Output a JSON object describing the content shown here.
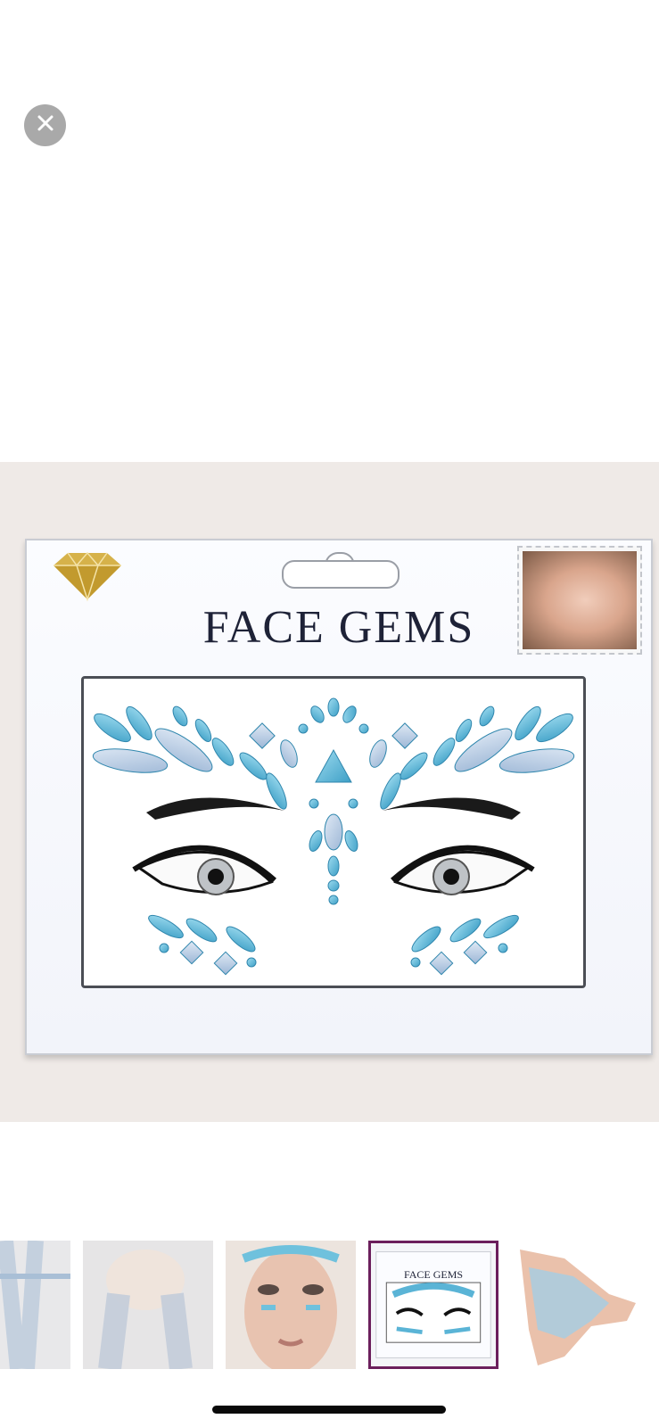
{
  "viewer": {
    "close_icon": "close-icon",
    "close_button_color": "#a9a9a9"
  },
  "product": {
    "package_title": "FACE GEMS",
    "background_color": "#efeae7",
    "gem_color": "#5ab4d6"
  },
  "thumbnails": {
    "items": [
      {
        "name": "lace-stockings-front"
      },
      {
        "name": "lace-stockings-back"
      },
      {
        "name": "model-face-gems"
      },
      {
        "name": "face-gems-package",
        "title": "FACE GEMS",
        "selected": true
      },
      {
        "name": "lace-gloves"
      }
    ],
    "selected_border_color": "#6b1f5c"
  }
}
